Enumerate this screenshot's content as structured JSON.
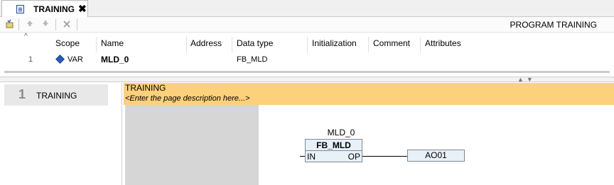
{
  "tab": {
    "title": "TRAINING",
    "close": "✖",
    "icon": "program-icon"
  },
  "toolbar": {
    "icons": [
      "auto-declare-icon",
      "move-up-icon",
      "move-down-icon",
      "delete-icon"
    ],
    "program_label": "PROGRAM TRAINING"
  },
  "declarations": {
    "sort_indicator": "^",
    "headers": [
      "Scope",
      "Name",
      "Address",
      "Data type",
      "Initialization",
      "Comment",
      "Attributes"
    ],
    "rows": [
      {
        "num": "1",
        "scope_icon": "variable-icon",
        "scope": "VAR",
        "name": "MLD_0",
        "address": "",
        "data_type": "FB_MLD",
        "initialization": "",
        "comment": "",
        "attributes": ""
      }
    ]
  },
  "splitter": {
    "arrows": "▲▼"
  },
  "outline": {
    "pages": [
      {
        "num": "1",
        "name": "TRAINING"
      }
    ]
  },
  "page": {
    "title": "TRAINING",
    "description": "<Enter the page description here...>"
  },
  "fbd": {
    "instance": "MLD_0",
    "type": "FB_MLD",
    "input": "IN",
    "output": "OP",
    "output_var": "AO01"
  },
  "colors": {
    "page_header": "#fdd07c",
    "block_fill": "#e8f0f8",
    "gray_area": "#d6d6d6"
  }
}
